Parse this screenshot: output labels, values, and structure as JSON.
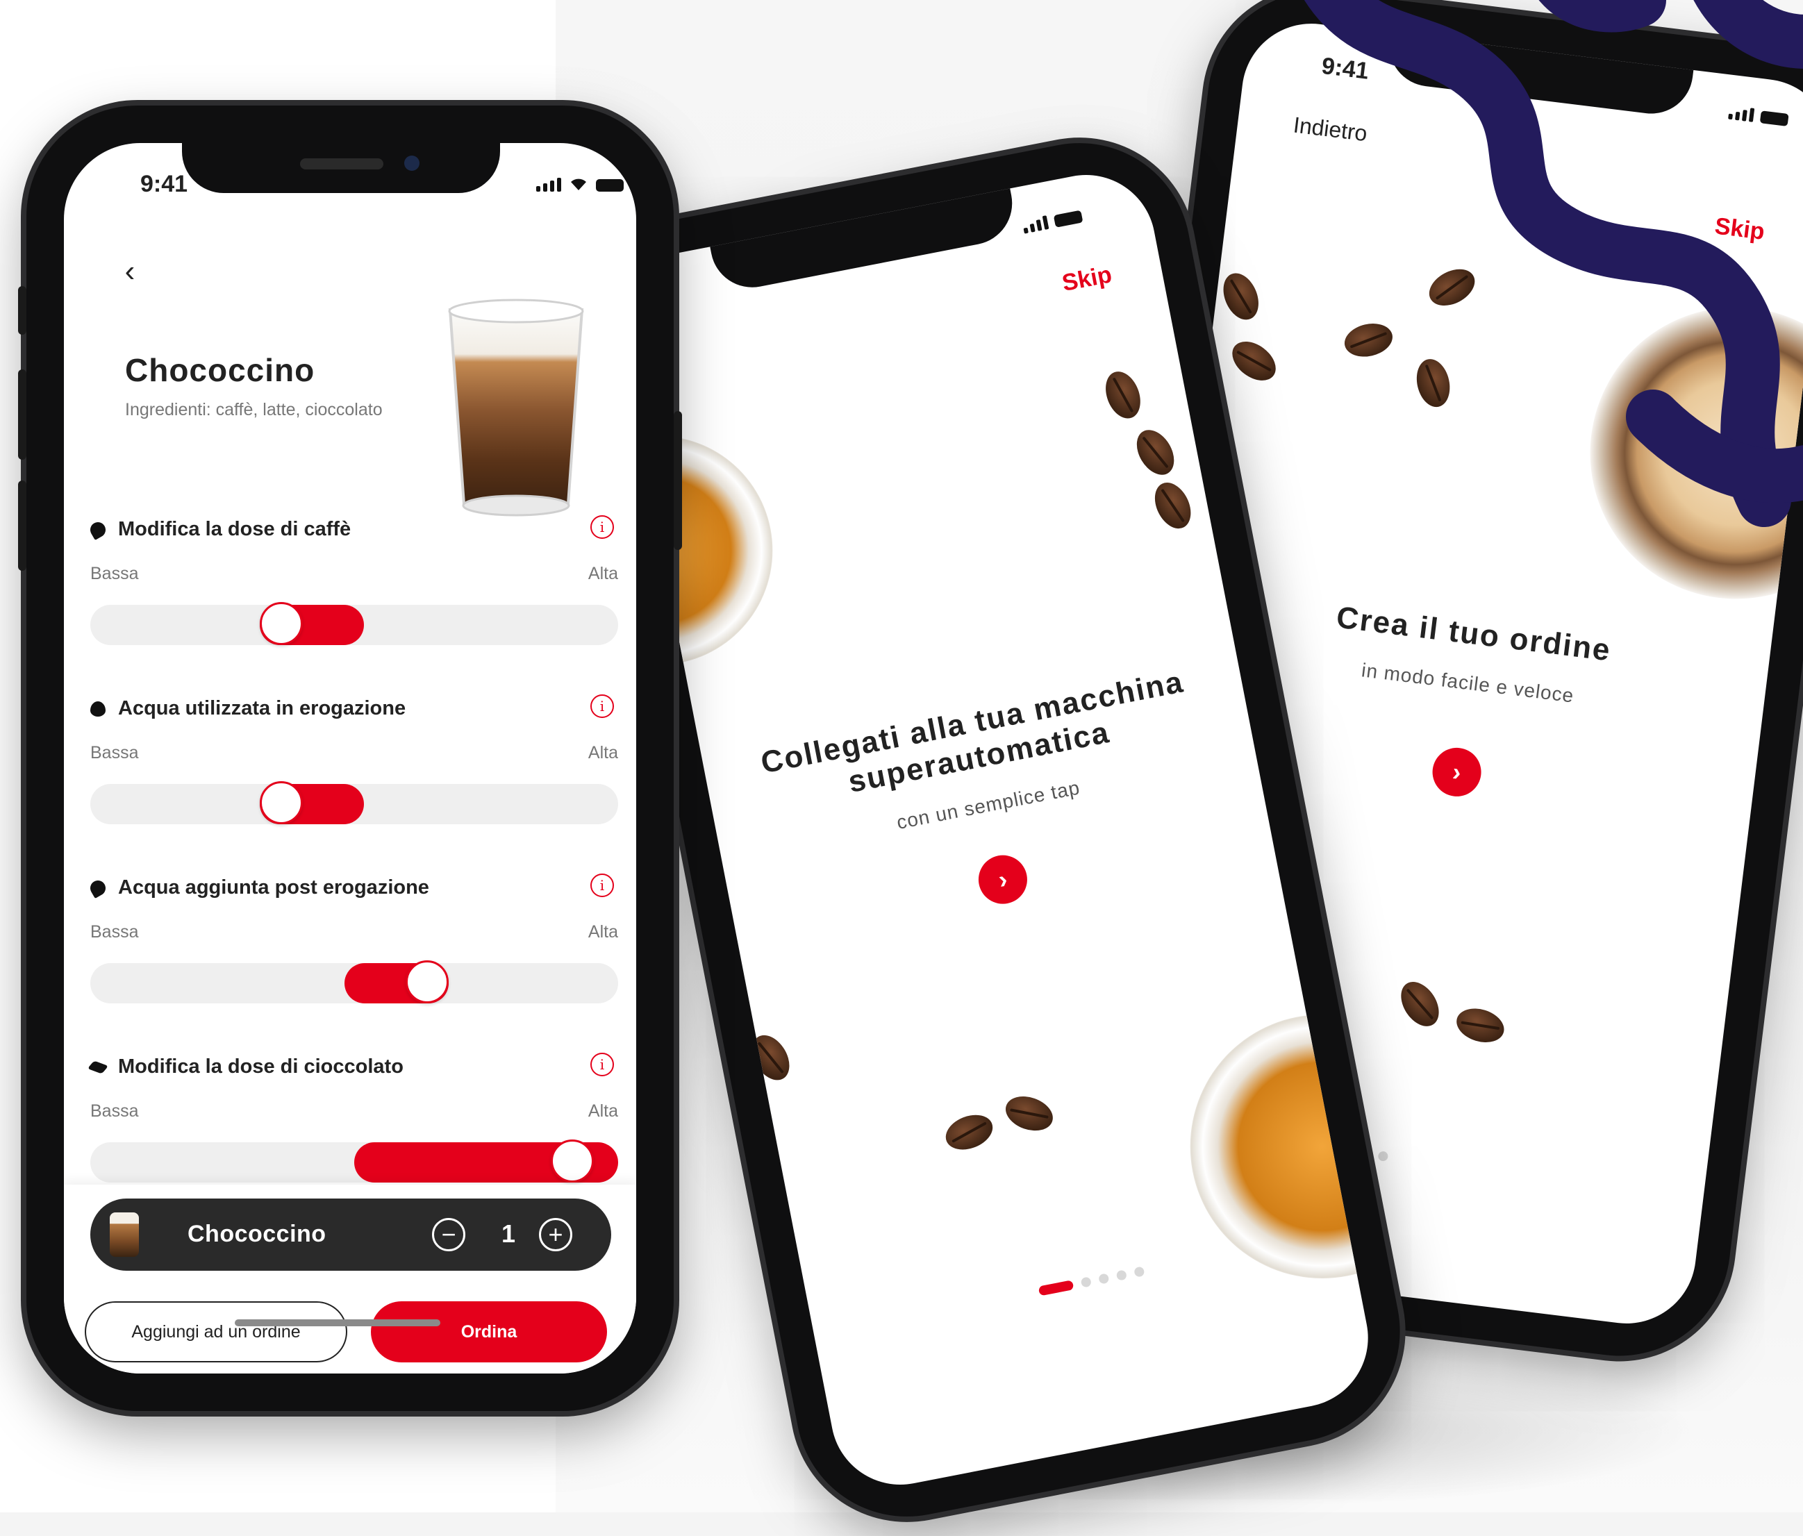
{
  "colors": {
    "accent": "#e4001b",
    "dark_pill": "#2a2a2a",
    "brand_swirl": "#231b5c"
  },
  "phone1": {
    "status": {
      "time": "9:41"
    },
    "product": {
      "name": "Chococcino",
      "ingredients": "Ingredienti: caffè, latte, cioccolato"
    },
    "options": [
      {
        "label": "Modifica la dose di caffè",
        "low": "Bassa",
        "high": "Alta",
        "level": 0.35,
        "icon": "coffee-bean-icon"
      },
      {
        "label": "Acqua utilizzata in erogazione",
        "low": "Bassa",
        "high": "Alta",
        "level": 0.35,
        "icon": "water-drop-icon"
      },
      {
        "label": "Acqua aggiunta post erogazione",
        "low": "Bassa",
        "high": "Alta",
        "level": 0.65,
        "icon": "water-drops-icon"
      },
      {
        "label": "Modifica la dose di cioccolato",
        "low": "Bassa",
        "high": "Alta",
        "level": 0.95,
        "icon": "chocolate-icon"
      }
    ],
    "cart": {
      "name": "Chococcino",
      "quantity": "1",
      "minus": "−",
      "plus": "+"
    },
    "buttons": {
      "add_to_order": "Aggiungi ad un ordine",
      "order": "Ordina"
    }
  },
  "phone2": {
    "skip": "Skip",
    "title": "Collegati alla tua macchina superautomatica",
    "subtitle": "con un semplice tap",
    "next": "›",
    "pages": 5,
    "current_page": 1
  },
  "phone3": {
    "status": {
      "time": "9:41"
    },
    "back": "Indietro",
    "skip": "Skip",
    "title": "Crea il tuo ordine",
    "subtitle": "in modo facile e veloce",
    "next": "›"
  }
}
